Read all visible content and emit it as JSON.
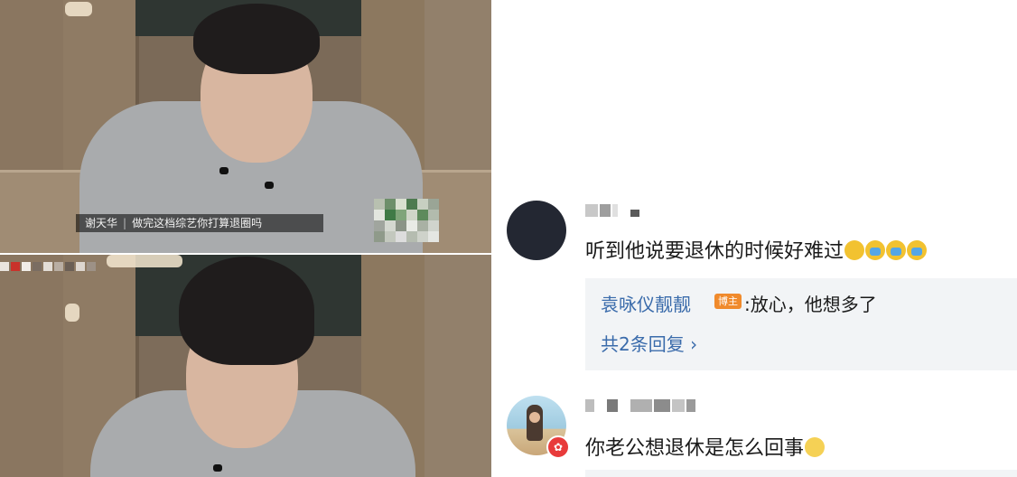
{
  "video": {
    "subtitle_speaker": "谢天华",
    "subtitle_text": "做完这档综艺你打算退圈吗"
  },
  "comments": [
    {
      "username": "",
      "text": "听到他说要退休的时候好难过",
      "emojis": [
        "sad-face-emoji",
        "crying-face-emoji",
        "crying-face-emoji",
        "crying-face-emoji"
      ],
      "reply": {
        "author": "袁咏仪靓靓",
        "author_badge": "博主",
        "text": ":放心，他想多了",
        "more": "共2条回复 ›"
      }
    },
    {
      "username": "",
      "text": "你老公想退休是怎么回事",
      "emojis": [
        "thinking-face-emoji"
      ],
      "avatar_badge": "✿"
    }
  ],
  "colors": {
    "link_blue": "#3a6bab",
    "blogger_badge": "#f08a2c",
    "reply_bg": "#f2f4f6",
    "vip_red": "#e83b3b"
  }
}
